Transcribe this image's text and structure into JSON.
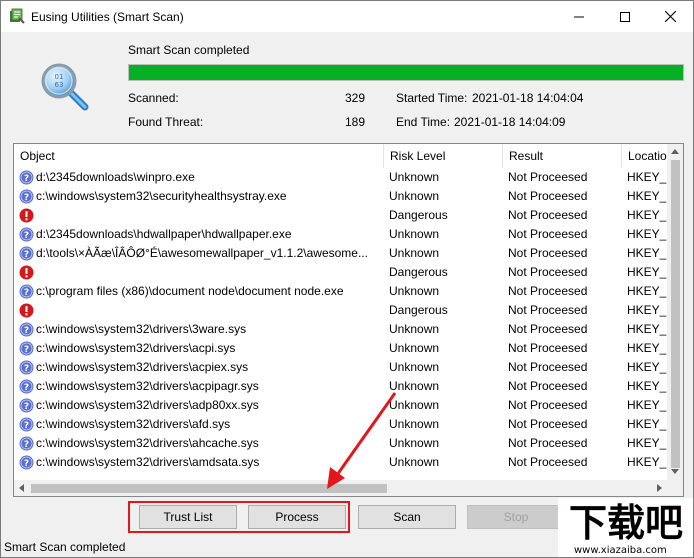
{
  "window": {
    "title": "Eusing Utilities (Smart Scan)"
  },
  "scan": {
    "status": "Smart Scan completed",
    "progress_percent": 100,
    "progress_color": "#06b025",
    "scanned_label": "Scanned:",
    "scanned_value": "329",
    "threat_label": "Found Threat:",
    "threat_value": "189",
    "started_label": "Started Time:",
    "started_value": "2021-01-18 14:04:04",
    "end_label": "End Time:",
    "end_value": "2021-01-18 14:04:09"
  },
  "table": {
    "columns": [
      "Object",
      "Risk Level",
      "Result",
      "Locatio"
    ],
    "rows": [
      {
        "icon": "info",
        "object": "d:\\2345downloads\\winpro.exe",
        "risk": "Unknown",
        "result": "Not Proceesed",
        "location": "HKEY_"
      },
      {
        "icon": "info",
        "object": "c:\\windows\\system32\\securityhealthsystray.exe",
        "risk": "Unknown",
        "result": "Not Proceesed",
        "location": "HKEY_"
      },
      {
        "icon": "danger",
        "object": "",
        "risk": "Dangerous",
        "result": "Not Proceesed",
        "location": "HKEY_"
      },
      {
        "icon": "info",
        "object": "d:\\2345downloads\\hdwallpaper\\hdwallpaper.exe",
        "risk": "Unknown",
        "result": "Not Proceesed",
        "location": "HKEY_"
      },
      {
        "icon": "info",
        "object": "d:\\tools\\×ÀÃæ\\ÎÂÔØ°É\\awesomewallpaper_v1.1.2\\awesome...",
        "risk": "Unknown",
        "result": "Not Proceesed",
        "location": "HKEY_"
      },
      {
        "icon": "danger",
        "object": "",
        "risk": "Dangerous",
        "result": "Not Proceesed",
        "location": "HKEY_"
      },
      {
        "icon": "info",
        "object": "c:\\program files (x86)\\document node\\document node.exe",
        "risk": "Unknown",
        "result": "Not Proceesed",
        "location": "HKEY_"
      },
      {
        "icon": "danger",
        "object": "",
        "risk": "Dangerous",
        "result": "Not Proceesed",
        "location": "HKEY_"
      },
      {
        "icon": "info",
        "object": "c:\\windows\\system32\\drivers\\3ware.sys",
        "risk": "Unknown",
        "result": "Not Proceesed",
        "location": "HKEY_"
      },
      {
        "icon": "info",
        "object": "c:\\windows\\system32\\drivers\\acpi.sys",
        "risk": "Unknown",
        "result": "Not Proceesed",
        "location": "HKEY_"
      },
      {
        "icon": "info",
        "object": "c:\\windows\\system32\\drivers\\acpiex.sys",
        "risk": "Unknown",
        "result": "Not Proceesed",
        "location": "HKEY_"
      },
      {
        "icon": "info",
        "object": "c:\\windows\\system32\\drivers\\acpipagr.sys",
        "risk": "Unknown",
        "result": "Not Proceesed",
        "location": "HKEY_"
      },
      {
        "icon": "info",
        "object": "c:\\windows\\system32\\drivers\\adp80xx.sys",
        "risk": "Unknown",
        "result": "Not Proceesed",
        "location": "HKEY_"
      },
      {
        "icon": "info",
        "object": "c:\\windows\\system32\\drivers\\afd.sys",
        "risk": "Unknown",
        "result": "Not Proceesed",
        "location": "HKEY_"
      },
      {
        "icon": "info",
        "object": "c:\\windows\\system32\\drivers\\ahcache.sys",
        "risk": "Unknown",
        "result": "Not Proceesed",
        "location": "HKEY_"
      },
      {
        "icon": "info",
        "object": "c:\\windows\\system32\\drivers\\amdsata.sys",
        "risk": "Unknown",
        "result": "Not Proceesed",
        "location": "HKEY_"
      }
    ]
  },
  "buttons": {
    "trust_list": "Trust List",
    "process": "Process",
    "scan": "Scan",
    "stop": "Stop"
  },
  "statusbar": {
    "text": "Smart Scan completed"
  },
  "watermark": {
    "cn": "下载吧",
    "url": "www.xiazaiba.com"
  },
  "colors": {
    "highlight": "#e3161b",
    "info_icon": "#5a6fd0",
    "danger_icon": "#d21a1a"
  }
}
